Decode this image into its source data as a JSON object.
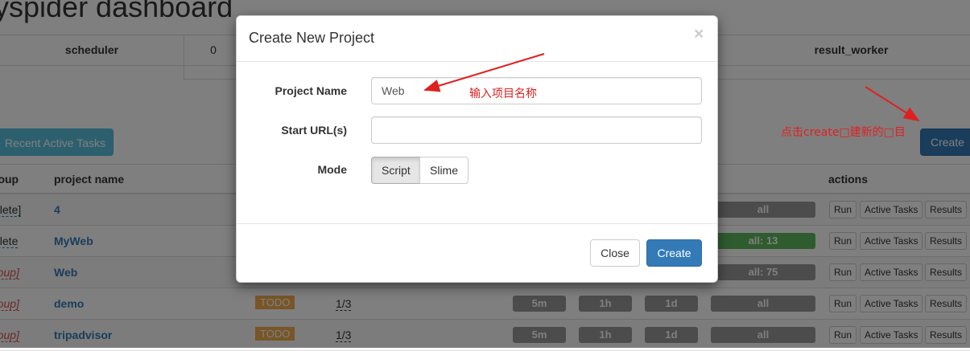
{
  "dashboard": {
    "title": "yspider dashboard",
    "stats": {
      "scheduler_label": "scheduler",
      "scheduler_value": "0",
      "result_worker_label": "result_worker"
    },
    "recent_tasks_label": "Recent Active Tasks",
    "create_label": "Create",
    "columns": {
      "group": "roup",
      "project_name": "project name",
      "actions": "actions"
    },
    "rows": [
      {
        "group": "elete]",
        "name": "4",
        "status": "",
        "rate": "",
        "all": "all",
        "all_color": "#999999"
      },
      {
        "group": "elete",
        "name": "MyWeb",
        "status": "",
        "rate": "",
        "all": "all: 13",
        "all_color": "#5cb85c"
      },
      {
        "group": "roup]",
        "name": "Web",
        "status": "",
        "rate": "",
        "all": "all: 75",
        "all_color": "#999999"
      },
      {
        "group": "roup]",
        "name": "demo",
        "status": "TODO",
        "rate": "1/3",
        "all": "all",
        "all_color": "#999999"
      },
      {
        "group": "roup]",
        "name": "tripadvisor",
        "status": "TODO",
        "rate": "1/3",
        "all": "all",
        "all_color": "#999999"
      }
    ],
    "time_pills": [
      "5m",
      "1h",
      "1d"
    ],
    "action_labels": {
      "run": "Run",
      "active_tasks": "Active Tasks",
      "results": "Results"
    }
  },
  "modal": {
    "title": "Create New Project",
    "close_symbol": "×",
    "project_name_label": "Project Name",
    "project_name_value": "Web",
    "start_urls_label": "Start URL(s)",
    "start_urls_value": "",
    "mode_label": "Mode",
    "mode_options": [
      "Script",
      "Slime"
    ],
    "mode_selected": "Script",
    "close_button": "Close",
    "create_button": "Create"
  },
  "annotations": {
    "name_hint": "输入项目名称",
    "create_hint": "点击create□建新的□目"
  }
}
